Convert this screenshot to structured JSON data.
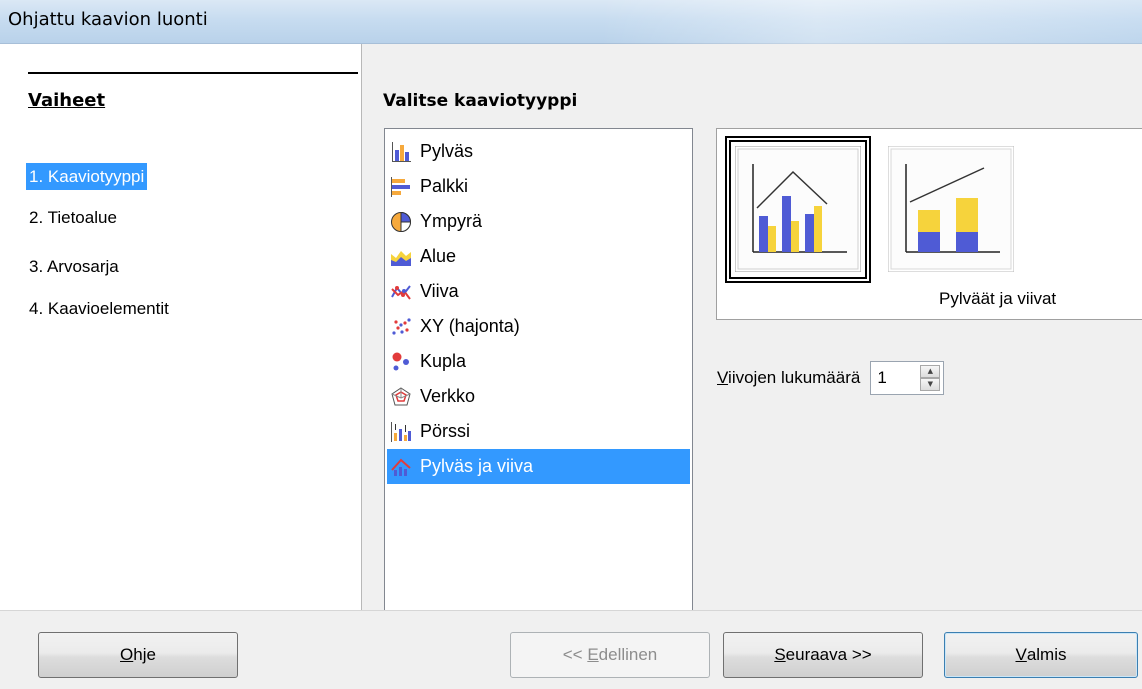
{
  "window": {
    "title": "Ohjattu kaavion luonti"
  },
  "steps": {
    "heading": "Vaiheet",
    "items": [
      {
        "label": "1. Kaaviotyyppi",
        "active": true
      },
      {
        "label": "2. Tietoalue",
        "active": false
      },
      {
        "label": "3. Arvosarja",
        "active": false
      },
      {
        "label": "4. Kaavioelementit",
        "active": false
      }
    ]
  },
  "main": {
    "heading": "Valitse kaaviotyyppi",
    "chart_types": [
      {
        "label": "Pylväs",
        "icon": "column-chart-icon"
      },
      {
        "label": "Palkki",
        "icon": "bar-chart-icon"
      },
      {
        "label": "Ympyrä",
        "icon": "pie-chart-icon"
      },
      {
        "label": "Alue",
        "icon": "area-chart-icon"
      },
      {
        "label": "Viiva",
        "icon": "line-chart-icon"
      },
      {
        "label": "XY (hajonta)",
        "icon": "scatter-chart-icon"
      },
      {
        "label": "Kupla",
        "icon": "bubble-chart-icon"
      },
      {
        "label": "Verkko",
        "icon": "net-chart-icon"
      },
      {
        "label": "Pörssi",
        "icon": "stock-chart-icon"
      },
      {
        "label": "Pylväs ja viiva",
        "icon": "column-line-chart-icon",
        "selected": true
      }
    ],
    "variant_caption": "Pylväät ja viivat",
    "line_count": {
      "label_prefix": "V",
      "label_rest": "iivojen lukumäärä",
      "value": "1"
    }
  },
  "buttons": {
    "help": {
      "u": "O",
      "rest": "hje"
    },
    "back": {
      "pre": "<< ",
      "u": "E",
      "rest": "dellinen"
    },
    "next": {
      "u": "S",
      "rest": "euraava >>"
    },
    "finish": {
      "u": "V",
      "rest": "almis"
    }
  },
  "colors": {
    "selection": "#3399ff",
    "bar_blue": "#4f5bd5",
    "bar_yellow": "#f6d33c"
  }
}
